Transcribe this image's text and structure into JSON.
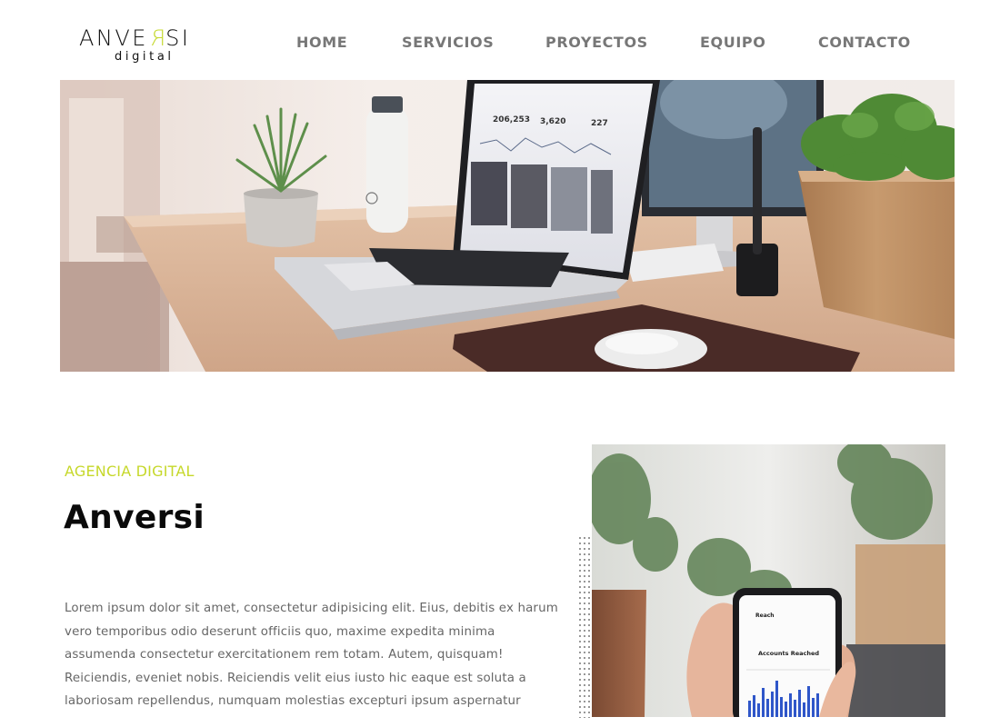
{
  "brand": {
    "logo_prefix": "ANVE",
    "logo_mirrored": "R",
    "logo_suffix": "SI",
    "logo_sub": "digital",
    "accent_color": "#c5d92f"
  },
  "nav": {
    "items": [
      "HOME",
      "SERVICIOS",
      "PROYECTOS",
      "EQUIPO",
      "CONTACTO"
    ]
  },
  "hero": {
    "image": "desk-laptop-photo",
    "stats": [
      {
        "value": "206,253"
      },
      {
        "value": "3,620"
      },
      {
        "value": "227"
      }
    ]
  },
  "about": {
    "eyebrow": "AGENCIA DIGITAL",
    "title": "Anversi",
    "paragraph": "Lorem ipsum dolor sit amet, consectetur adipisicing elit. Eius, debitis ex harum vero temporibus odio deserunt officiis quo, maxime expedita minima assumenda consectetur exercitationem rem totam. Autem, quisquam! Reiciendis, eveniet nobis. Reiciendis velit eius iusto hic eaque est soluta a laboriosam repellendus, numquam molestias excepturi ipsum aspernatur",
    "image": "phone-analytics-photo",
    "phone_header": "Reach",
    "phone_card_title": "Accounts Reached"
  }
}
